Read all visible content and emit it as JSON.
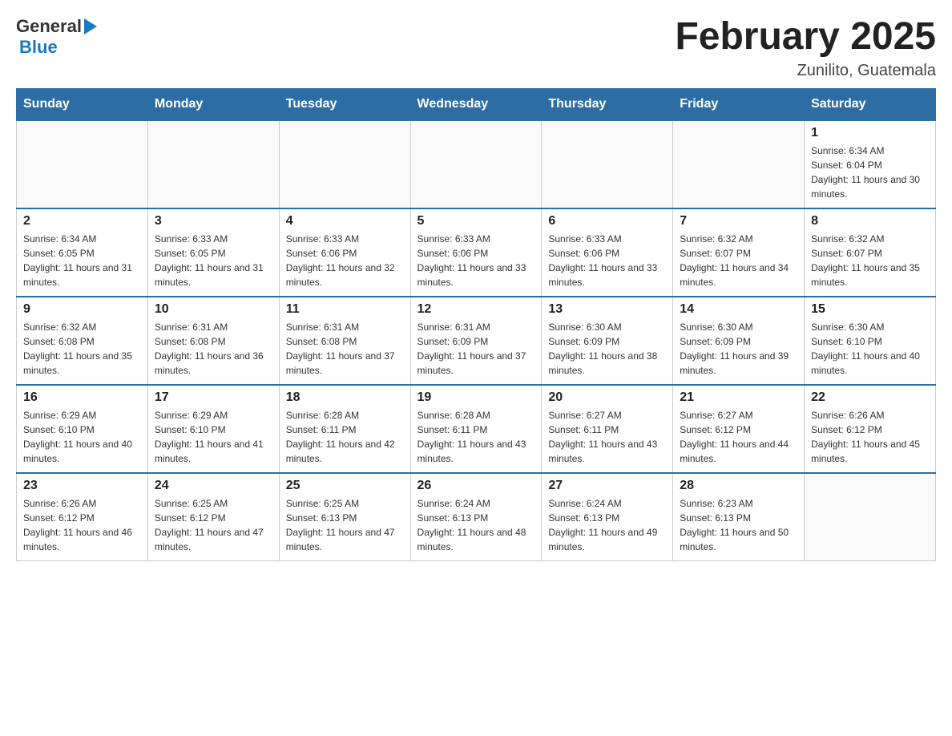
{
  "header": {
    "logo_general": "General",
    "logo_blue": "Blue",
    "month_title": "February 2025",
    "location": "Zunilito, Guatemala"
  },
  "days_of_week": [
    "Sunday",
    "Monday",
    "Tuesday",
    "Wednesday",
    "Thursday",
    "Friday",
    "Saturday"
  ],
  "weeks": [
    [
      {
        "day": "",
        "sunrise": "",
        "sunset": "",
        "daylight": ""
      },
      {
        "day": "",
        "sunrise": "",
        "sunset": "",
        "daylight": ""
      },
      {
        "day": "",
        "sunrise": "",
        "sunset": "",
        "daylight": ""
      },
      {
        "day": "",
        "sunrise": "",
        "sunset": "",
        "daylight": ""
      },
      {
        "day": "",
        "sunrise": "",
        "sunset": "",
        "daylight": ""
      },
      {
        "day": "",
        "sunrise": "",
        "sunset": "",
        "daylight": ""
      },
      {
        "day": "1",
        "sunrise": "Sunrise: 6:34 AM",
        "sunset": "Sunset: 6:04 PM",
        "daylight": "Daylight: 11 hours and 30 minutes."
      }
    ],
    [
      {
        "day": "2",
        "sunrise": "Sunrise: 6:34 AM",
        "sunset": "Sunset: 6:05 PM",
        "daylight": "Daylight: 11 hours and 31 minutes."
      },
      {
        "day": "3",
        "sunrise": "Sunrise: 6:33 AM",
        "sunset": "Sunset: 6:05 PM",
        "daylight": "Daylight: 11 hours and 31 minutes."
      },
      {
        "day": "4",
        "sunrise": "Sunrise: 6:33 AM",
        "sunset": "Sunset: 6:06 PM",
        "daylight": "Daylight: 11 hours and 32 minutes."
      },
      {
        "day": "5",
        "sunrise": "Sunrise: 6:33 AM",
        "sunset": "Sunset: 6:06 PM",
        "daylight": "Daylight: 11 hours and 33 minutes."
      },
      {
        "day": "6",
        "sunrise": "Sunrise: 6:33 AM",
        "sunset": "Sunset: 6:06 PM",
        "daylight": "Daylight: 11 hours and 33 minutes."
      },
      {
        "day": "7",
        "sunrise": "Sunrise: 6:32 AM",
        "sunset": "Sunset: 6:07 PM",
        "daylight": "Daylight: 11 hours and 34 minutes."
      },
      {
        "day": "8",
        "sunrise": "Sunrise: 6:32 AM",
        "sunset": "Sunset: 6:07 PM",
        "daylight": "Daylight: 11 hours and 35 minutes."
      }
    ],
    [
      {
        "day": "9",
        "sunrise": "Sunrise: 6:32 AM",
        "sunset": "Sunset: 6:08 PM",
        "daylight": "Daylight: 11 hours and 35 minutes."
      },
      {
        "day": "10",
        "sunrise": "Sunrise: 6:31 AM",
        "sunset": "Sunset: 6:08 PM",
        "daylight": "Daylight: 11 hours and 36 minutes."
      },
      {
        "day": "11",
        "sunrise": "Sunrise: 6:31 AM",
        "sunset": "Sunset: 6:08 PM",
        "daylight": "Daylight: 11 hours and 37 minutes."
      },
      {
        "day": "12",
        "sunrise": "Sunrise: 6:31 AM",
        "sunset": "Sunset: 6:09 PM",
        "daylight": "Daylight: 11 hours and 37 minutes."
      },
      {
        "day": "13",
        "sunrise": "Sunrise: 6:30 AM",
        "sunset": "Sunset: 6:09 PM",
        "daylight": "Daylight: 11 hours and 38 minutes."
      },
      {
        "day": "14",
        "sunrise": "Sunrise: 6:30 AM",
        "sunset": "Sunset: 6:09 PM",
        "daylight": "Daylight: 11 hours and 39 minutes."
      },
      {
        "day": "15",
        "sunrise": "Sunrise: 6:30 AM",
        "sunset": "Sunset: 6:10 PM",
        "daylight": "Daylight: 11 hours and 40 minutes."
      }
    ],
    [
      {
        "day": "16",
        "sunrise": "Sunrise: 6:29 AM",
        "sunset": "Sunset: 6:10 PM",
        "daylight": "Daylight: 11 hours and 40 minutes."
      },
      {
        "day": "17",
        "sunrise": "Sunrise: 6:29 AM",
        "sunset": "Sunset: 6:10 PM",
        "daylight": "Daylight: 11 hours and 41 minutes."
      },
      {
        "day": "18",
        "sunrise": "Sunrise: 6:28 AM",
        "sunset": "Sunset: 6:11 PM",
        "daylight": "Daylight: 11 hours and 42 minutes."
      },
      {
        "day": "19",
        "sunrise": "Sunrise: 6:28 AM",
        "sunset": "Sunset: 6:11 PM",
        "daylight": "Daylight: 11 hours and 43 minutes."
      },
      {
        "day": "20",
        "sunrise": "Sunrise: 6:27 AM",
        "sunset": "Sunset: 6:11 PM",
        "daylight": "Daylight: 11 hours and 43 minutes."
      },
      {
        "day": "21",
        "sunrise": "Sunrise: 6:27 AM",
        "sunset": "Sunset: 6:12 PM",
        "daylight": "Daylight: 11 hours and 44 minutes."
      },
      {
        "day": "22",
        "sunrise": "Sunrise: 6:26 AM",
        "sunset": "Sunset: 6:12 PM",
        "daylight": "Daylight: 11 hours and 45 minutes."
      }
    ],
    [
      {
        "day": "23",
        "sunrise": "Sunrise: 6:26 AM",
        "sunset": "Sunset: 6:12 PM",
        "daylight": "Daylight: 11 hours and 46 minutes."
      },
      {
        "day": "24",
        "sunrise": "Sunrise: 6:25 AM",
        "sunset": "Sunset: 6:12 PM",
        "daylight": "Daylight: 11 hours and 47 minutes."
      },
      {
        "day": "25",
        "sunrise": "Sunrise: 6:25 AM",
        "sunset": "Sunset: 6:13 PM",
        "daylight": "Daylight: 11 hours and 47 minutes."
      },
      {
        "day": "26",
        "sunrise": "Sunrise: 6:24 AM",
        "sunset": "Sunset: 6:13 PM",
        "daylight": "Daylight: 11 hours and 48 minutes."
      },
      {
        "day": "27",
        "sunrise": "Sunrise: 6:24 AM",
        "sunset": "Sunset: 6:13 PM",
        "daylight": "Daylight: 11 hours and 49 minutes."
      },
      {
        "day": "28",
        "sunrise": "Sunrise: 6:23 AM",
        "sunset": "Sunset: 6:13 PM",
        "daylight": "Daylight: 11 hours and 50 minutes."
      },
      {
        "day": "",
        "sunrise": "",
        "sunset": "",
        "daylight": ""
      }
    ]
  ]
}
